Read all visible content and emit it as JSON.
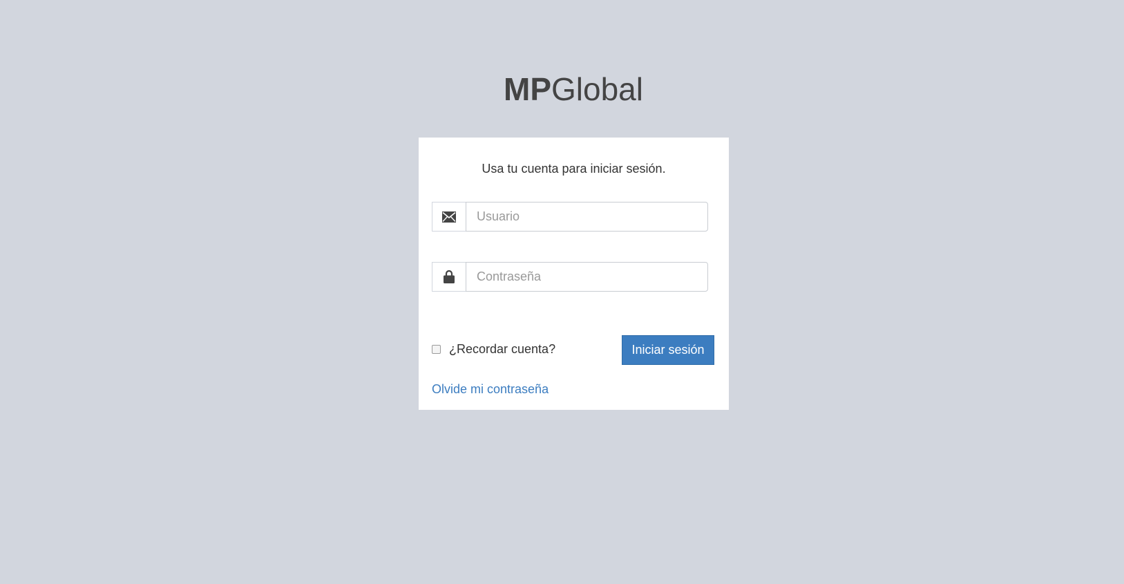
{
  "logo": {
    "bold": "MP",
    "light": "Global"
  },
  "login": {
    "message": "Usa tu cuenta para iniciar sesión.",
    "username": {
      "placeholder": "Usuario",
      "value": "",
      "icon": "envelope-icon"
    },
    "password": {
      "placeholder": "Contraseña",
      "value": "",
      "icon": "lock-icon"
    },
    "remember_label": "¿Recordar cuenta?",
    "remember_checked": false,
    "submit_label": "Iniciar sesión",
    "forgot_label": "Olvide mi contraseña"
  },
  "colors": {
    "background": "#d2d6de",
    "primary": "#3c7dc0",
    "text": "#333333"
  }
}
